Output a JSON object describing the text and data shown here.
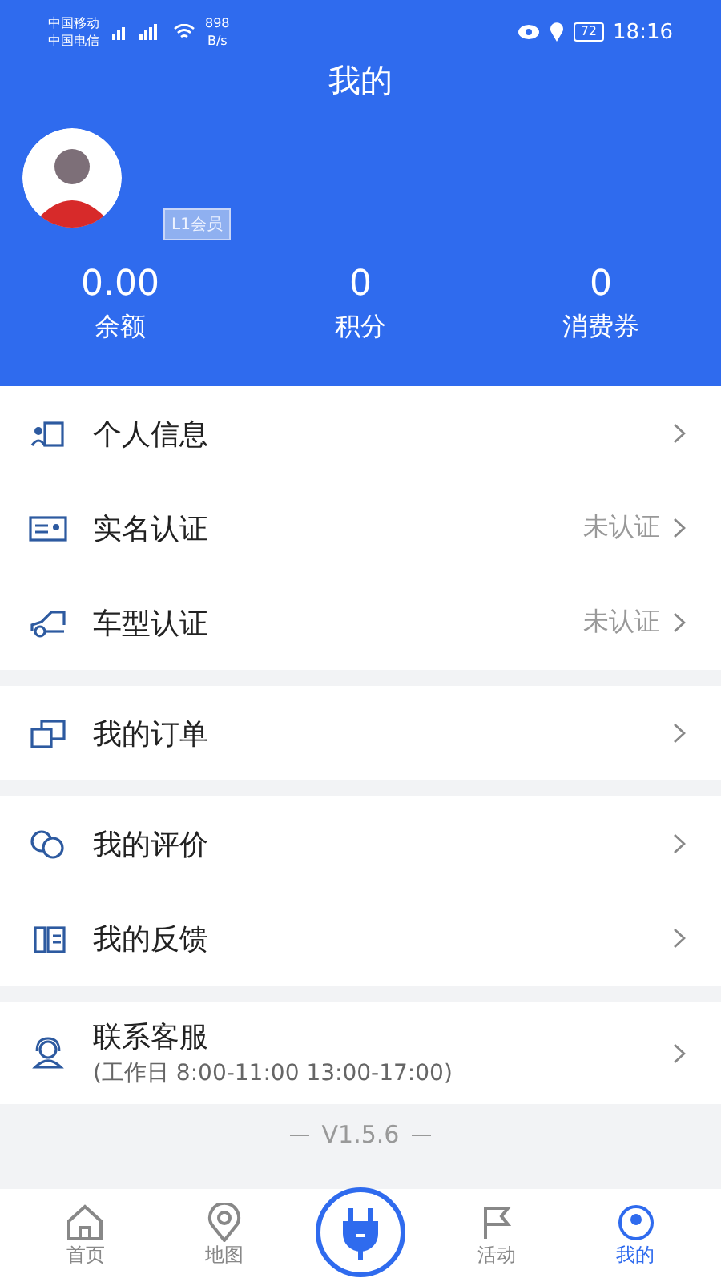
{
  "status_bar": {
    "carriers": [
      "中国移动",
      "中国电信"
    ],
    "speed": [
      "898",
      "B/s"
    ],
    "battery": "72",
    "time": "18:16"
  },
  "header": {
    "title": "我的",
    "member_badge": "L1会员"
  },
  "stats": [
    {
      "value": "0.00",
      "label": "余额"
    },
    {
      "value": "0",
      "label": "积分"
    },
    {
      "value": "0",
      "label": "消费券"
    }
  ],
  "groups": [
    [
      {
        "label": "个人信息"
      },
      {
        "label": "实名认证",
        "status": "未认证"
      },
      {
        "label": "车型认证",
        "status": "未认证"
      }
    ],
    [
      {
        "label": "我的订单"
      }
    ],
    [
      {
        "label": "我的评价"
      },
      {
        "label": "我的反馈"
      }
    ],
    [
      {
        "label": "联系客服",
        "sub": "(工作日 8:00-11:00 13:00-17:00)"
      }
    ]
  ],
  "version": "V1.5.6",
  "nav": [
    {
      "kind": "tab",
      "label": "首页",
      "selected": false
    },
    {
      "kind": "tab",
      "label": "地图",
      "selected": false
    },
    {
      "kind": "center"
    },
    {
      "kind": "tab",
      "label": "活动",
      "selected": false
    },
    {
      "kind": "tab",
      "label": "我的",
      "selected": true
    }
  ]
}
